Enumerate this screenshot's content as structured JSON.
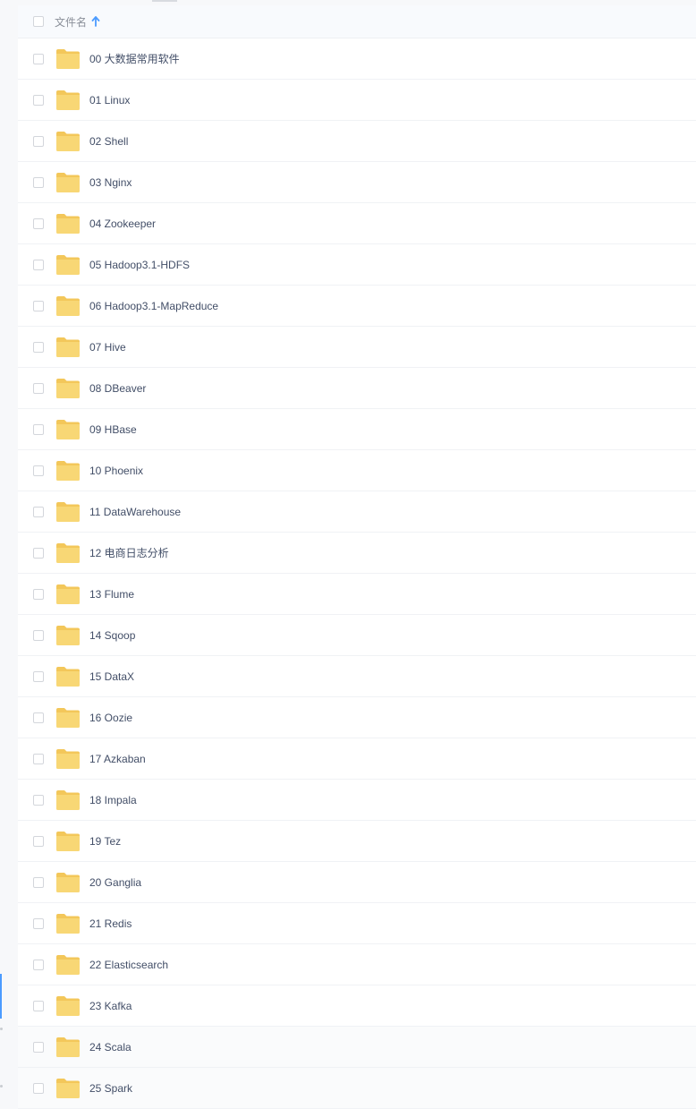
{
  "header": {
    "column_label": "文件名",
    "sort_icon": "arrow-up-icon"
  },
  "colors": {
    "accent": "#4b9bff",
    "folder": "#f8d775",
    "folder_tab": "#f3c75a",
    "text": "#424e67"
  },
  "folder_icon": "folder-icon",
  "files": [
    {
      "name": "00 大数据常用软件"
    },
    {
      "name": "01 Linux"
    },
    {
      "name": "02 Shell"
    },
    {
      "name": "03 Nginx"
    },
    {
      "name": "04 Zookeeper"
    },
    {
      "name": "05 Hadoop3.1-HDFS"
    },
    {
      "name": "06 Hadoop3.1-MapReduce"
    },
    {
      "name": "07 Hive"
    },
    {
      "name": "08 DBeaver"
    },
    {
      "name": "09 HBase"
    },
    {
      "name": "10 Phoenix"
    },
    {
      "name": "11 DataWarehouse"
    },
    {
      "name": "12 电商日志分析"
    },
    {
      "name": "13 Flume"
    },
    {
      "name": "14 Sqoop"
    },
    {
      "name": "15 DataX"
    },
    {
      "name": "16 Oozie"
    },
    {
      "name": "17 Azkaban"
    },
    {
      "name": "18 Impala"
    },
    {
      "name": "19 Tez"
    },
    {
      "name": "20 Ganglia"
    },
    {
      "name": "21 Redis"
    },
    {
      "name": "22 Elasticsearch"
    },
    {
      "name": "23 Kafka"
    },
    {
      "name": "24 Scala"
    },
    {
      "name": "25 Spark"
    }
  ]
}
